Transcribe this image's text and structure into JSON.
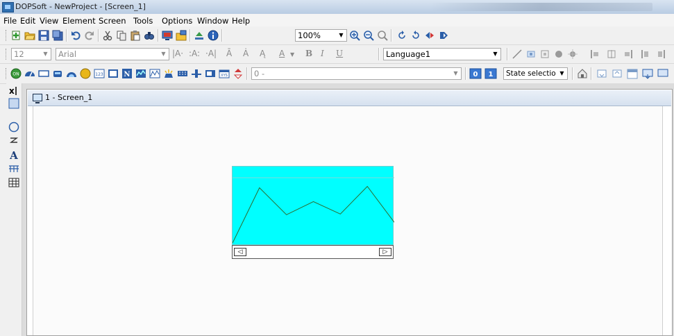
{
  "window": {
    "title": "DOPSoft - NewProject - [Screen_1]"
  },
  "menu": [
    "File",
    "Edit",
    "View",
    "Element",
    "Screen",
    "Tools",
    "Options",
    "Window",
    "Help"
  ],
  "toolbar1": {
    "zoom_value": "100%"
  },
  "toolbar2": {
    "font_size": "12",
    "font_name": "Arial",
    "language": "Language1"
  },
  "toolbar3": {
    "range_value": "0 -",
    "state_value": "0",
    "state_value_2": "1",
    "state_select": "State selectio"
  },
  "document": {
    "tab_title": "1 - Screen_1"
  },
  "trend_graph": {
    "line_color": "#2e6b2e",
    "fill_color": "#00ffff",
    "points": [
      0,
      80,
      41,
      60,
      42,
      82,
      30
    ]
  },
  "palette_tools": [
    "select-tool",
    "rectangle-tool",
    "ellipse-tool",
    "polyline-tool",
    "text-tool",
    "scale-tool",
    "table-tool"
  ]
}
